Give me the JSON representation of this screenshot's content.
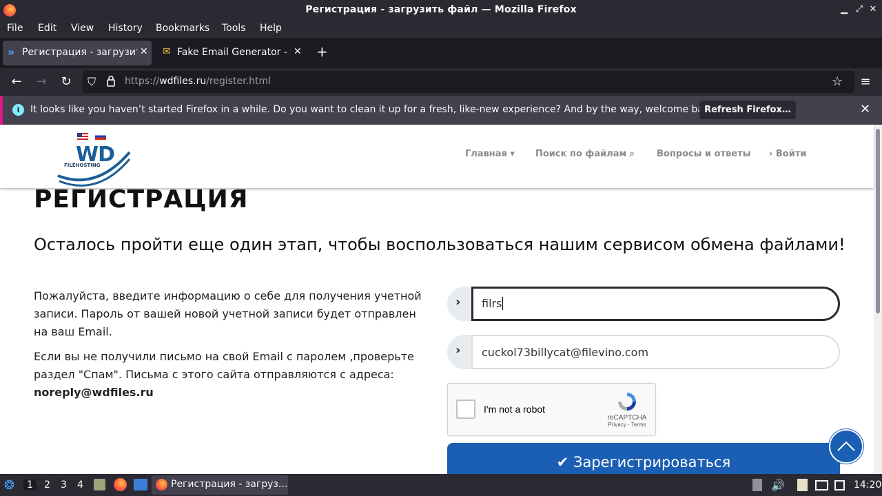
{
  "window": {
    "title": "Регистрация - загрузить файл — Mozilla Firefox",
    "minimize_icon": "minimize-icon",
    "maximize_icon": "maximize-icon",
    "close_icon": "close-icon"
  },
  "menu": [
    "File",
    "Edit",
    "View",
    "History",
    "Bookmarks",
    "Tools",
    "Help"
  ],
  "tabs": [
    {
      "label": "Регистрация - загрузить",
      "active": true
    },
    {
      "label": "Fake Email Generator - te",
      "active": false
    }
  ],
  "navbar": {
    "url_prefix": "https://",
    "url_host": "wdfiles.ru",
    "url_path": "/register.html"
  },
  "notification": {
    "message": "It looks like you haven’t started Firefox in a while. Do you want to clean it up for a fresh, like-new experience? And by the way, welcome back!",
    "button": "Refresh Firefox…",
    "accent": "#e31587"
  },
  "site": {
    "logo_text": "WD",
    "logo_sub": "FILEHOSTING",
    "nav": [
      "Главная ▾",
      "Поиск по файлам ⌕",
      "Вопросы и ответы",
      "› Войти"
    ],
    "heading": "РЕГИСТРАЦИЯ",
    "subheading": "Осталось пройти еще один этап, чтобы воспользоваться нашим сервисом обмена файлами!",
    "para1": "Пожалуйста, введите информацию о себе для получения учетной записи. Пароль от вашей новой учетной записи будет отправлен на ваш Email.",
    "para2": "Если вы не получили письмо на свой Email с паролем ,проверьте раздел \"Спам\". Письма с этого сайта отправляются с адреса:",
    "email_from": "noreply@wdfiles.ru",
    "username_value": "filrs",
    "email_value": "cuckol73billycat@filevino.com",
    "captcha_label": "I'm not a robot",
    "captcha_brand": "reCAPTCHA",
    "captcha_links": "Privacy - Terms",
    "submit_label": "✔ Зарегистрироваться",
    "accent": "#1a5fb4"
  },
  "taskbar": {
    "workspaces": [
      "1",
      "2",
      "3",
      "4"
    ],
    "task_label": "Регистрация - загруз...",
    "clock": "14:20"
  }
}
